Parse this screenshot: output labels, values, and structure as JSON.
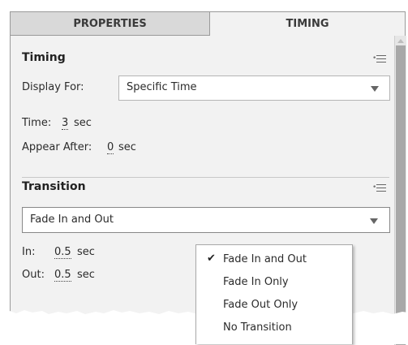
{
  "tabs": [
    {
      "label": "PROPERTIES"
    },
    {
      "label": "TIMING"
    }
  ],
  "timing": {
    "title": "Timing",
    "display_for_label": "Display For:",
    "display_for_value": "Specific Time",
    "time_label": "Time:",
    "time_value": "3",
    "time_unit": "sec",
    "appear_after_label": "Appear After:",
    "appear_after_value": "0",
    "appear_after_unit": "sec"
  },
  "transition": {
    "title": "Transition",
    "selected": "Fade In and Out",
    "in_label": "In:",
    "in_value": "0.5",
    "in_unit": "sec",
    "out_label": "Out:",
    "out_value": "0.5",
    "out_unit": "sec"
  },
  "dropdown": {
    "items": [
      {
        "label": "Fade In and Out",
        "checked": true
      },
      {
        "label": "Fade In Only",
        "checked": false
      },
      {
        "label": "Fade Out Only",
        "checked": false
      },
      {
        "label": "No Transition",
        "checked": false
      }
    ]
  },
  "icons": {
    "panel_menu": "panel-menu-icon",
    "check": "checkmark-icon",
    "dropdown_arrow": "chevron-down-icon"
  },
  "colors": {
    "panel_bg": "#f2f2f2",
    "inactive_tab_bg": "#d9d9d9",
    "scroll_thumb": "#a8a8a8"
  }
}
